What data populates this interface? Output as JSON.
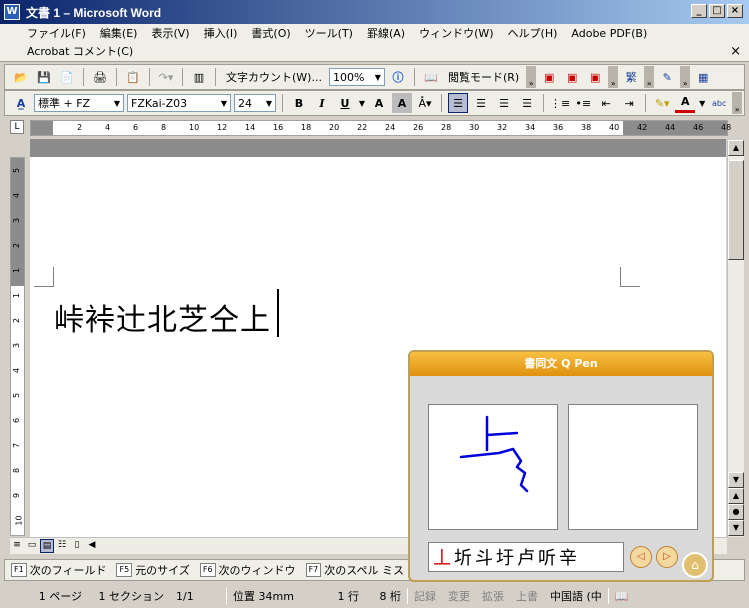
{
  "window": {
    "title": "文書 1 – Microsoft Word",
    "app_icon": "W",
    "buttons": [
      "_",
      "□",
      "×"
    ]
  },
  "menu": {
    "row1": [
      "ファイル(F)",
      "編集(E)",
      "表示(V)",
      "挿入(I)",
      "書式(O)",
      "ツール(T)",
      "罫線(A)",
      "ウィンドウ(W)",
      "ヘルプ(H)",
      "Adobe PDF(B)"
    ],
    "row2": [
      "Acrobat コメント(C)"
    ],
    "close": "×"
  },
  "toolbar_standard": {
    "word_count": "文字カウント(W)...",
    "zoom": "100%",
    "reading_mode": "閲覧モード(R)"
  },
  "toolbar_format": {
    "style": "標準 + FZ",
    "font": "FZKai-Z03",
    "size": "24",
    "bold": "B",
    "italic": "I",
    "underline": "U",
    "char_a": "A",
    "font_color_a": "A",
    "abc": "abc"
  },
  "ruler": {
    "h_ticks": [
      "2",
      "4",
      "6",
      "8",
      "10",
      "12",
      "14",
      "16",
      "18",
      "20",
      "22",
      "24",
      "26",
      "28",
      "30",
      "32",
      "34",
      "36",
      "38",
      "40",
      "42",
      "44",
      "46",
      "48"
    ],
    "v_ticks": [
      "5",
      "4",
      "3",
      "2",
      "1",
      "1",
      "2",
      "3",
      "4",
      "5",
      "6",
      "7",
      "8",
      "9",
      "10"
    ],
    "corner": "L"
  },
  "document": {
    "text": "峠裃辻北芝仝上"
  },
  "qpen": {
    "title": "書同文 Q Pen",
    "candidates": [
      "丄",
      "圻",
      "斗",
      "圩",
      "卢",
      "听",
      "辛"
    ],
    "prev": "◁",
    "next": "▷",
    "home": "⌂"
  },
  "fkeys": [
    {
      "key": "F1",
      "label": "次のフィールド"
    },
    {
      "key": "F5",
      "label": "元のサイズ"
    },
    {
      "key": "F6",
      "label": "次のウィンドウ"
    },
    {
      "key": "F7",
      "label": "次のスペル ミス"
    }
  ],
  "status": {
    "page": "1 ページ",
    "section": "1 セクション",
    "pages": "1/1",
    "position": "位置  34mm",
    "line": "1 行",
    "column": "8 桁",
    "rec": "記録",
    "trk": "変更",
    "ext": "拡張",
    "ovr": "上書",
    "lang": "中国語 (中"
  }
}
